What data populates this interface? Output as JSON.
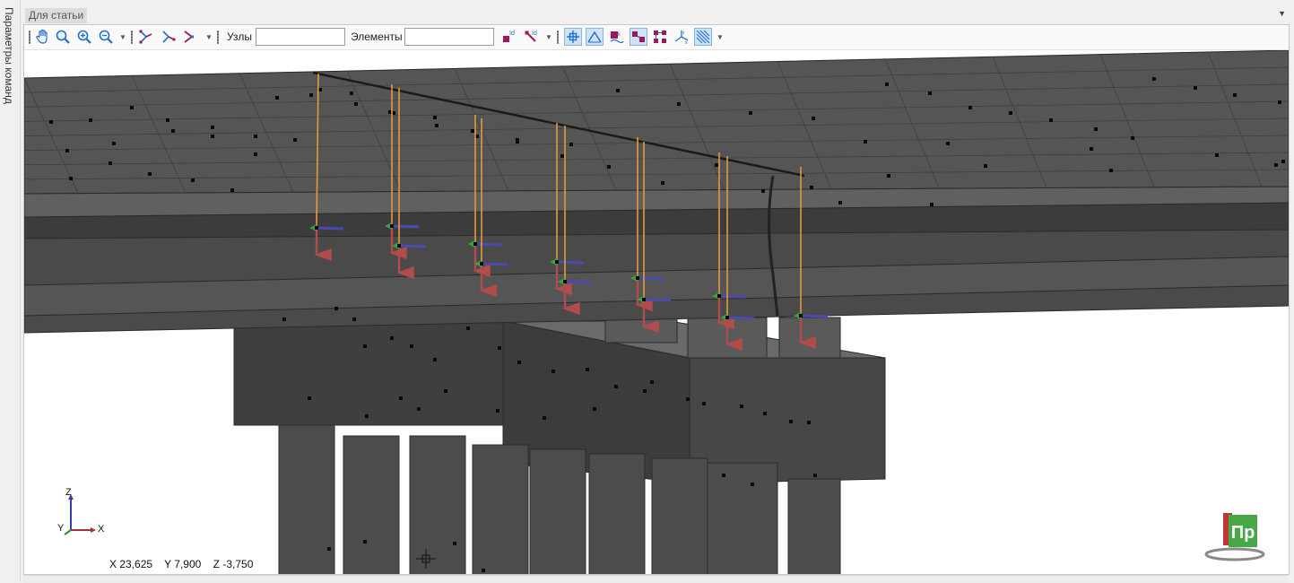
{
  "side_panel": {
    "label": "Параметры команд"
  },
  "document_tab": {
    "title": "Для статьи",
    "menu_glyph": "▼"
  },
  "toolbar": {
    "nodes_label": "Узлы",
    "nodes_value": "",
    "elements_label": "Элементы",
    "elements_value": "",
    "dropdown_glyph": "▼",
    "icons": [
      "pan-hand-icon",
      "zoom-window-icon",
      "zoom-in-icon",
      "zoom-out-icon",
      "select-nodes-icon",
      "select-elements-icon",
      "select-mode-icon",
      "node-id-icon",
      "element-id-icon",
      "node-marker-icon",
      "show-triangle-icon",
      "load-values-icon",
      "stretch-icon",
      "fragment-icon",
      "local-axes-icon",
      "hatch-icon"
    ]
  },
  "viewport": {
    "axis": {
      "z": "Z",
      "y": "Y",
      "x": "X"
    },
    "coordinates": {
      "x": "X  23,625",
      "y": "Y  7,900",
      "z": "Z  -3,750"
    },
    "logo_text": "Пр"
  },
  "colors": {
    "toolbar_icon_blue": "#1f6fd1",
    "toolbar_icon_magenta": "#a1165a",
    "load_arrow": "#b24b4b",
    "axis_arrow": "#4a4ab0",
    "node_arrow": "#3aa33a",
    "support_line": "#e39a3b",
    "model_dark": "#474747"
  }
}
